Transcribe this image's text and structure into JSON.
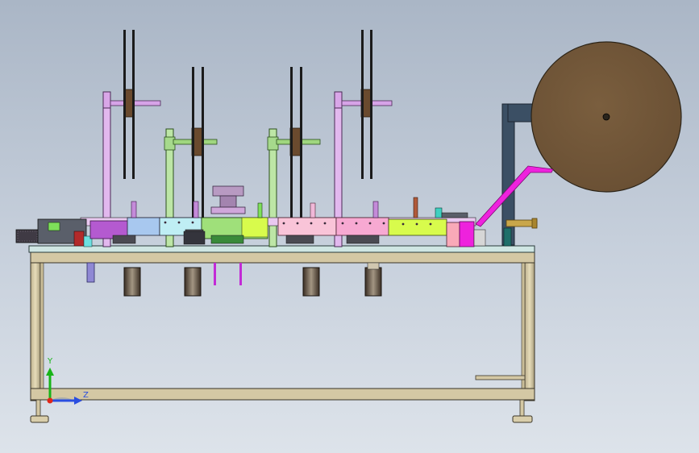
{
  "viewport": {
    "background_top": "#aab6c6",
    "background_bottom": "#dde3ea"
  },
  "triad": {
    "y_label": "Y",
    "z_label": "Z",
    "y_color": "#18b418",
    "z_color": "#2a4ee0"
  },
  "colors": {
    "frame": "#d4c8a4",
    "frame_edge": "#3a3528",
    "roll": "#6e5336",
    "table_top": "#cfe6e3",
    "purple_stand": "#e2b8ee",
    "green_stand": "#bde6a6",
    "magenta": "#ee22dd",
    "pink": "#f7a9d2",
    "lime": "#d8fb4c",
    "cyan": "#bfeef4",
    "dark_post": "#3b4f64",
    "spool_hub": "#6a4a2e"
  }
}
